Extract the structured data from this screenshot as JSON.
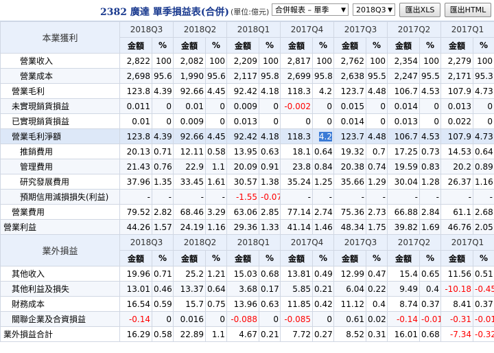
{
  "header": {
    "title": "2382 廣達 單季損益表(合併)",
    "unit": "(單位:億元)",
    "report_select": "合併報表 – 單季",
    "quarter_select": "2018Q3",
    "export_xls": "匯出XLS",
    "export_html": "匯出HTML"
  },
  "periods": [
    "2018Q3",
    "2018Q2",
    "2018Q1",
    "2017Q4",
    "2017Q3",
    "2017Q2",
    "2017Q1"
  ],
  "col_amount": "金額",
  "col_pct": "%",
  "sections": [
    {
      "title": "本業獲利",
      "rows": [
        {
          "label": "營業收入",
          "indent": 2,
          "cells": [
            "2,822",
            "100",
            "2,082",
            "100",
            "2,209",
            "100",
            "2,817",
            "100",
            "2,762",
            "100",
            "2,354",
            "100",
            "2,279",
            "100"
          ]
        },
        {
          "label": "營業成本",
          "indent": 2,
          "cells": [
            "2,698",
            "95.6",
            "1,990",
            "95.6",
            "2,117",
            "95.8",
            "2,699",
            "95.8",
            "2,638",
            "95.5",
            "2,247",
            "95.5",
            "2,171",
            "95.3"
          ]
        },
        {
          "label": "營業毛利",
          "indent": 1,
          "cells": [
            "123.8",
            "4.39",
            "92.66",
            "4.45",
            "92.42",
            "4.18",
            "118.3",
            "4.2",
            "123.7",
            "4.48",
            "106.7",
            "4.53",
            "107.9",
            "4.73"
          ]
        },
        {
          "label": "未實現銷貨損益",
          "indent": 1,
          "cells": [
            "0.011",
            "0",
            "0.01",
            "0",
            "0.009",
            "0",
            "-0.002",
            "0",
            "0.015",
            "0",
            "0.014",
            "0",
            "0.013",
            "0"
          ]
        },
        {
          "label": "已實現銷貨損益",
          "indent": 1,
          "cells": [
            "0.01",
            "0",
            "0.009",
            "0",
            "0.013",
            "0",
            "0",
            "0",
            "0.014",
            "0",
            "0.013",
            "0",
            "0.022",
            "0"
          ]
        },
        {
          "label": "營業毛利淨額",
          "indent": 1,
          "cells": [
            "123.8",
            "4.39",
            "92.66",
            "4.45",
            "92.42",
            "4.18",
            "118.3",
            "4.2",
            "123.7",
            "4.48",
            "106.7",
            "4.53",
            "107.9",
            "4.73"
          ]
        },
        {
          "label": "推銷費用",
          "indent": 2,
          "cells": [
            "20.13",
            "0.71",
            "12.11",
            "0.58",
            "13.95",
            "0.63",
            "18.1",
            "0.64",
            "19.32",
            "0.7",
            "17.25",
            "0.73",
            "14.53",
            "0.64"
          ]
        },
        {
          "label": "管理費用",
          "indent": 2,
          "cells": [
            "21.43",
            "0.76",
            "22.9",
            "1.1",
            "20.09",
            "0.91",
            "23.8",
            "0.84",
            "20.38",
            "0.74",
            "19.59",
            "0.83",
            "20.2",
            "0.89"
          ]
        },
        {
          "label": "研究發展費用",
          "indent": 2,
          "cells": [
            "37.96",
            "1.35",
            "33.45",
            "1.61",
            "30.57",
            "1.38",
            "35.24",
            "1.25",
            "35.66",
            "1.29",
            "30.04",
            "1.28",
            "26.37",
            "1.16"
          ]
        },
        {
          "label": "預期信用減損損失(利益)",
          "indent": 2,
          "cells": [
            "-",
            "-",
            "-",
            "-",
            "-1.55",
            "-0.07",
            "-",
            "-",
            "-",
            "-",
            "-",
            "-",
            "-",
            "-"
          ]
        },
        {
          "label": "營業費用",
          "indent": 1,
          "cells": [
            "79.52",
            "2.82",
            "68.46",
            "3.29",
            "63.06",
            "2.85",
            "77.14",
            "2.74",
            "75.36",
            "2.73",
            "66.88",
            "2.84",
            "61.1",
            "2.68"
          ]
        },
        {
          "label": "營業利益",
          "indent": 0,
          "cells": [
            "44.26",
            "1.57",
            "24.19",
            "1.16",
            "29.36",
            "1.33",
            "41.14",
            "1.46",
            "48.34",
            "1.75",
            "39.82",
            "1.69",
            "46.76",
            "2.05"
          ]
        }
      ]
    },
    {
      "title": "業外損益",
      "rows": [
        {
          "label": "其他收入",
          "indent": 1,
          "cells": [
            "19.96",
            "0.71",
            "25.2",
            "1.21",
            "15.03",
            "0.68",
            "13.81",
            "0.49",
            "12.99",
            "0.47",
            "15.4",
            "0.65",
            "11.56",
            "0.51"
          ]
        },
        {
          "label": "其他利益及損失",
          "indent": 1,
          "cells": [
            "13.01",
            "0.46",
            "13.37",
            "0.64",
            "3.68",
            "0.17",
            "5.85",
            "0.21",
            "6.04",
            "0.22",
            "9.49",
            "0.4",
            "-10.18",
            "-0.45"
          ]
        },
        {
          "label": "財務成本",
          "indent": 1,
          "cells": [
            "16.54",
            "0.59",
            "15.7",
            "0.75",
            "13.96",
            "0.63",
            "11.85",
            "0.42",
            "11.12",
            "0.4",
            "8.74",
            "0.37",
            "8.41",
            "0.37"
          ]
        },
        {
          "label": "關聯企業及合資損益",
          "indent": 1,
          "cells": [
            "-0.14",
            "0",
            "0.016",
            "0",
            "-0.088",
            "0",
            "-0.085",
            "0",
            "0.61",
            "0.02",
            "-0.14",
            "-0.01",
            "-0.31",
            "-0.01"
          ]
        },
        {
          "label": "業外損益合計",
          "indent": 0,
          "cells": [
            "16.29",
            "0.58",
            "22.89",
            "1.1",
            "4.67",
            "0.21",
            "7.72",
            "0.27",
            "8.52",
            "0.31",
            "16.01",
            "0.68",
            "-7.34",
            "-0.32"
          ]
        }
      ]
    }
  ],
  "highlight": {
    "section": 0,
    "row": 5,
    "cell": 7
  }
}
